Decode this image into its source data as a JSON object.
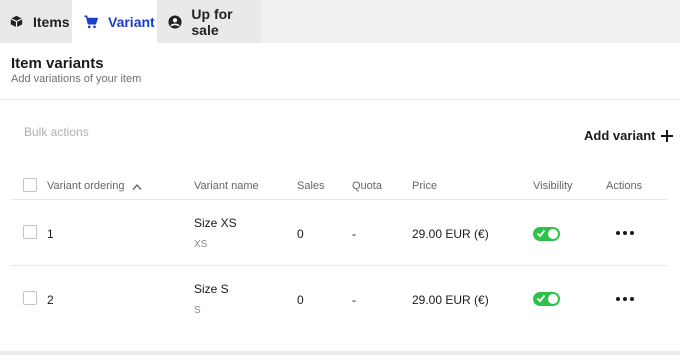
{
  "tabs": [
    {
      "label": "Items",
      "icon": "box-icon"
    },
    {
      "label": "Variant",
      "icon": "cart-icon"
    },
    {
      "label": "Up for sale",
      "icon": "user-circle-icon"
    }
  ],
  "active_tab": "Variant",
  "colors": {
    "accent": "#1b3fc6",
    "toggle_on": "#2ec24a"
  },
  "header": {
    "title": "Item variants",
    "subtitle": "Add variations of your item"
  },
  "toolbar": {
    "bulk_actions": "Bulk actions",
    "add_variant": "Add variant"
  },
  "table": {
    "columns": {
      "ordering": "Variant ordering",
      "name": "Variant name",
      "sales": "Sales",
      "quota": "Quota",
      "price": "Price",
      "visibility": "Visibility",
      "actions": "Actions"
    },
    "sort": "ascending",
    "rows": [
      {
        "order": "1",
        "name": "Size XS",
        "code": "XS",
        "sales": "0",
        "quota": "-",
        "price": "29.00 EUR (€)",
        "visible": true
      },
      {
        "order": "2",
        "name": "Size S",
        "code": "S",
        "sales": "0",
        "quota": "-",
        "price": "29.00 EUR (€)",
        "visible": true
      }
    ]
  }
}
